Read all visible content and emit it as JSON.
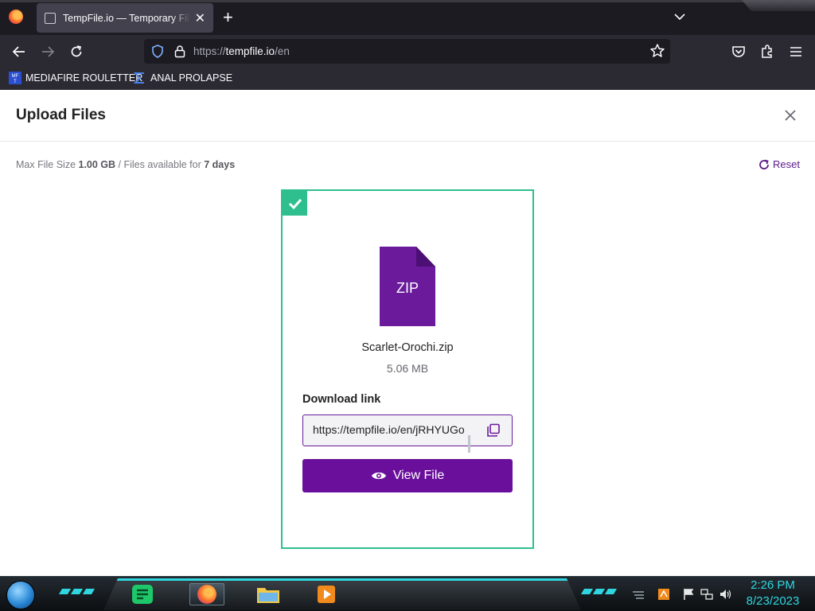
{
  "browser": {
    "tab_title": "TempFile.io — Temporary File Upload",
    "url_scheme": "https://",
    "url_host": "tempfile.io",
    "url_path": "/en",
    "bookmarks": [
      {
        "label": "MEDIAFIRE ROULETTER",
        "icon": "mediafire-icon"
      },
      {
        "label": "ANAL PROLAPSE",
        "icon": "sigma-icon"
      }
    ]
  },
  "page": {
    "title": "Upload Files",
    "info_prefix": "Max File Size ",
    "max_size": "1.00 GB",
    "info_middle": " / Files available for ",
    "days": "7 days",
    "reset_label": "Reset"
  },
  "file": {
    "type_label": "ZIP",
    "name": "Scarlet-Orochi.zip",
    "size": "5.06 MB",
    "download_label": "Download link",
    "download_url": "https://tempfile.io/en/jRHYUGo",
    "view_label": "View File"
  },
  "taskbar": {
    "time": "2:26 PM",
    "date": "8/23/2023"
  },
  "colors": {
    "accent": "#6a0f9c",
    "success": "#2fbf8f",
    "clock": "#2fd6e0"
  }
}
